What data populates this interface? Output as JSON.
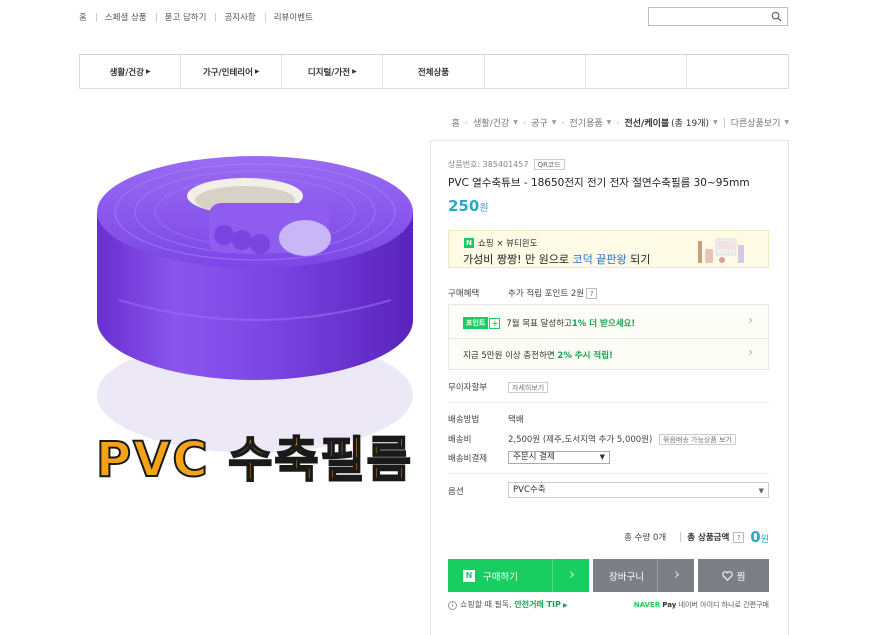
{
  "top_nav": [
    "홈",
    "스페셜 상품",
    "묻고 답하기",
    "공지사항",
    "리뷰이벤트"
  ],
  "search": {
    "placeholder": ""
  },
  "categories": [
    "생활/건강",
    "가구/인테리어",
    "디지털/가전",
    "전체상품",
    "",
    "",
    ""
  ],
  "breadcrumb": {
    "items": [
      "홈",
      "생활/건강",
      "공구",
      "전기용품"
    ],
    "current": "전선/케이블",
    "count": "(총 19개)",
    "other": "다른상품보기"
  },
  "product": {
    "number_label": "상품번호: 385401457",
    "qr_label": "QR코드",
    "title": "PVC 열수축튜브 - 18650전지 전기 전자 절연수축필름 30~95mm",
    "price": "250",
    "price_unit": "원",
    "image_caption": "PVC 수축필름"
  },
  "banner": {
    "badge": "N",
    "top": "쇼핑 × 뷰티윈도",
    "main_pre": "가성비 짱짱! 만 원으로 ",
    "main_green": "",
    "main_blue": "코덕 끝판왕",
    "main_post": " 되기"
  },
  "benefit": {
    "label": "구매혜택",
    "value": "추가 적립 포인트 2원",
    "help": "?"
  },
  "points": {
    "tag": "포인트",
    "plus": "+",
    "line1_pre": "7월 목표 달성하고 ",
    "line1_em": "1% 더 받으세요!",
    "line2_pre": "지금 5만원 이상 충전하면 ",
    "line2_em": "2% 추시 적립!"
  },
  "installment": {
    "label": "무이자할부",
    "button": "자세히보기"
  },
  "shipping": {
    "method_label": "배송방법",
    "method_value": "택배",
    "fee_label": "배송비",
    "fee_value": "2,500원 (제주,도서지역 추가 5,000원)",
    "fee_button": "묶음배송 가능상품 보기",
    "pay_label": "배송비결제",
    "pay_value": "주문시 결제"
  },
  "option": {
    "label": "옵션",
    "value": "PVC수축"
  },
  "totals": {
    "qty": "총 수량 0개",
    "label": "총 상품금액",
    "help": "?",
    "amount": "0",
    "unit": "원"
  },
  "buttons": {
    "buy_badge": "N",
    "buy": "구매하기",
    "cart": "장바구니",
    "wish": "찜"
  },
  "footer": {
    "safe_pre": "쇼핑할 때 필독, ",
    "safe_em": "안전거래 TIP",
    "naverpay_brand": "NAVER",
    "naverpay_pay": "Pay",
    "naverpay_text": "네이버 아이디 하나로 간편구매"
  },
  "colors": {
    "naver_green": "#19ce60",
    "price_blue": "#2fa7c3",
    "gray_button": "#7d7f86",
    "caption_orange": "#f5a21b"
  }
}
